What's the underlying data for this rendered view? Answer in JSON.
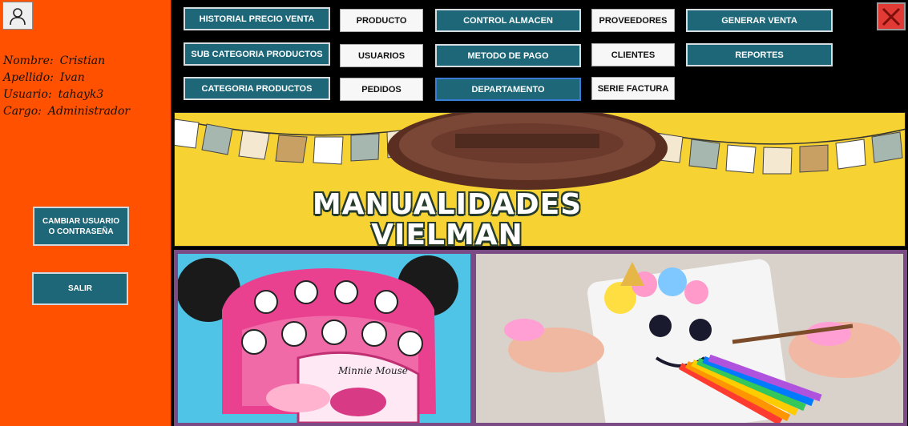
{
  "user": {
    "labels": [
      "Nombre:",
      "Apellido:",
      "Usuario:",
      "Cargo:"
    ],
    "values": [
      "Cristian",
      "Ivan",
      "tahayk3",
      "Administrador"
    ]
  },
  "sidebar": {
    "change_button": "CAMBIAR USUARIO O CONTRASEÑA",
    "logout_button": "SALIR"
  },
  "nav": {
    "historial_precio_venta": "HISTORIAL PRECIO VENTA",
    "producto": "PRODUCTO",
    "control_almacen": "CONTROL ALMACEN",
    "proveedores": "PROVEEDORES",
    "generar_venta": "GENERAR VENTA",
    "sub_categoria_productos": "SUB CATEGORIA PRODUCTOS",
    "usuarios": "USUARIOS",
    "metodo_de_pago": "METODO DE PAGO",
    "clientes": "CLIENTES",
    "reportes": "REPORTES",
    "categoria_productos": "CATEGORIA PRODUCTOS",
    "pedidos": "PEDIDOS",
    "departamento": "DEPARTAMENTO",
    "serie_factura": "SERIE FACTURA"
  },
  "banner": {
    "line1": "MANUALIDADES",
    "line2": "VIELMAN"
  },
  "photos": {
    "left_text": "Minnie Mouse"
  },
  "colors": {
    "sidebar": "#ff5100",
    "teal_button": "#1d6778",
    "banner": "#f7d233",
    "close": "#e23a35"
  },
  "icons": [
    "user-icon",
    "close-icon"
  ]
}
